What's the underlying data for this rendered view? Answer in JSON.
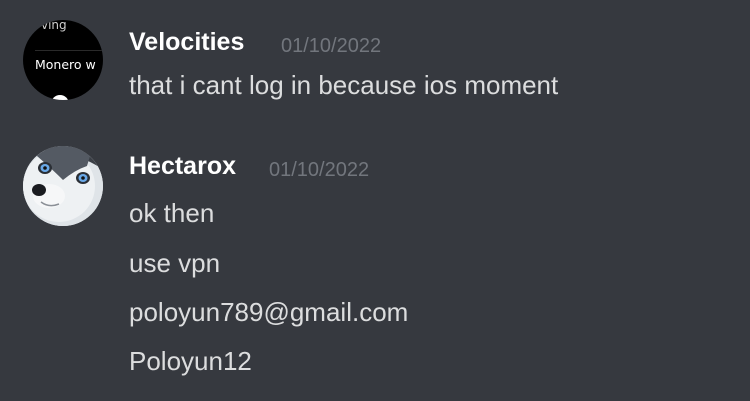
{
  "messages": [
    {
      "username": "Velocities",
      "timestamp": "01/10/2022",
      "avatar": {
        "icon": "user-avatar-icon",
        "top_text": "ving",
        "card_text": "Monero w"
      },
      "lines": [
        "that i cant log in because ios moment"
      ]
    },
    {
      "username": "Hectarox",
      "timestamp": "01/10/2022",
      "avatar": {
        "icon": "husky-avatar-icon"
      },
      "lines": [
        "ok then",
        "use vpn",
        "poloyun789@gmail.com",
        "Poloyun12"
      ]
    }
  ],
  "colors": {
    "background": "#36393f",
    "username": "#ffffff",
    "timestamp": "#72767d",
    "message_text": "#dcddde"
  }
}
